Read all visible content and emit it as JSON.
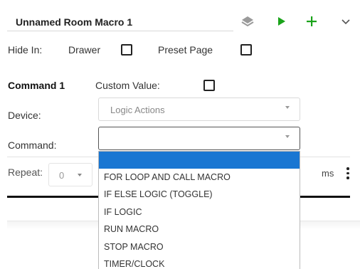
{
  "header": {
    "title": "Unnamed Room Macro 1"
  },
  "hide_in": {
    "label": "Hide In:",
    "drawer_label": "Drawer",
    "preset_label": "Preset Page"
  },
  "command": {
    "heading": "Command 1",
    "custom_value_label": "Custom Value:",
    "device_label": "Device:",
    "device_value": "Logic Actions",
    "command_label": "Command:",
    "command_value": ""
  },
  "repeat": {
    "label": "Repeat:",
    "value": "0",
    "unit": "ms"
  },
  "dropdown": {
    "options": [
      "",
      "FOR LOOP AND CALL MACRO",
      "IF ELSE LOGIC (TOGGLE)",
      "IF LOGIC",
      "RUN MACRO",
      "STOP MACRO",
      "TIMER/CLOCK"
    ],
    "selected_index": 0
  },
  "colors": {
    "accent_green": "#1aa31a",
    "selected_blue": "#1976d2"
  },
  "icons": [
    "layers-icon",
    "play-icon",
    "plus-icon",
    "chevron-down-icon",
    "kebab-menu-icon"
  ]
}
